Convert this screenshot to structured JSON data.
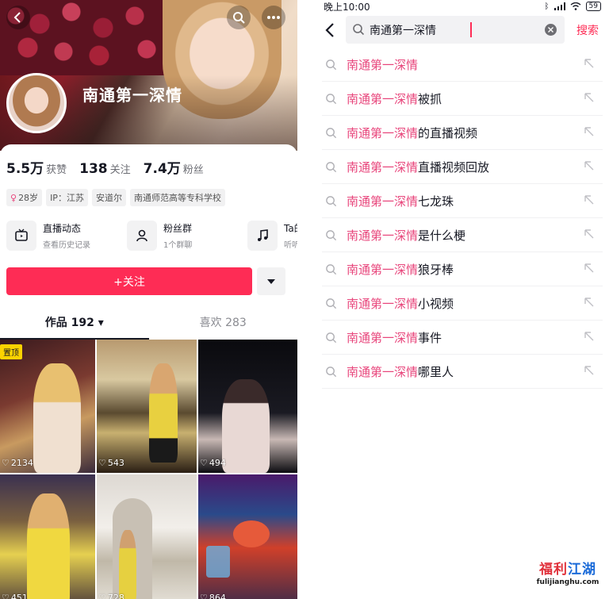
{
  "profile": {
    "name": "南通第一深情",
    "stats": [
      {
        "value": "5.5万",
        "label": "获赞"
      },
      {
        "value": "138",
        "label": "关注"
      },
      {
        "value": "7.4万",
        "label": "粉丝"
      }
    ],
    "tags": [
      "28岁",
      "IP：江苏",
      "安道尔",
      "南通师范高等专科学校"
    ],
    "features": [
      {
        "title": "直播动态",
        "subtitle": "查看历史记录",
        "icon": "tv-icon"
      },
      {
        "title": "粉丝群",
        "subtitle": "1个群聊",
        "icon": "group-icon"
      },
      {
        "title": "Ta的音乐",
        "subtitle": "听听ta的",
        "icon": "music-icon"
      }
    ],
    "follow_label": "+关注",
    "tabs": [
      {
        "label": "作品 192",
        "active": true
      },
      {
        "label": "喜欢 283",
        "active": false
      }
    ],
    "pinned_label": "置顶",
    "videos": [
      {
        "likes": "2134"
      },
      {
        "likes": "543"
      },
      {
        "likes": "494"
      },
      {
        "likes": "451"
      },
      {
        "likes": "728"
      },
      {
        "likes": "864"
      }
    ]
  },
  "search": {
    "status_time": "晚上10:00",
    "battery": "59",
    "query": "南通第一深情",
    "button_label": "搜索",
    "suggestions": [
      {
        "highlight": "南通第一深情",
        "rest": ""
      },
      {
        "highlight": "南通第一深情",
        "rest": "被抓"
      },
      {
        "highlight": "南通第一深情",
        "rest": "的直播视频"
      },
      {
        "highlight": "南通第一深情",
        "rest": "直播视频回放"
      },
      {
        "highlight": "南通第一深情",
        "rest": "七龙珠"
      },
      {
        "highlight": "南通第一深情",
        "rest": "是什么梗"
      },
      {
        "highlight": "南通第一深情",
        "rest": "狼牙棒"
      },
      {
        "highlight": "南通第一深情",
        "rest": "小视频"
      },
      {
        "highlight": "南通第一深情",
        "rest": "事件"
      },
      {
        "highlight": "南通第一深情",
        "rest": "哪里人"
      }
    ]
  },
  "watermark": {
    "title_part1": "福利",
    "title_part2": "江湖",
    "url": "fulijianghu.com"
  },
  "colors": {
    "accent": "#fe2c55",
    "highlight": "#e8467c",
    "pinned": "#fcd300"
  }
}
